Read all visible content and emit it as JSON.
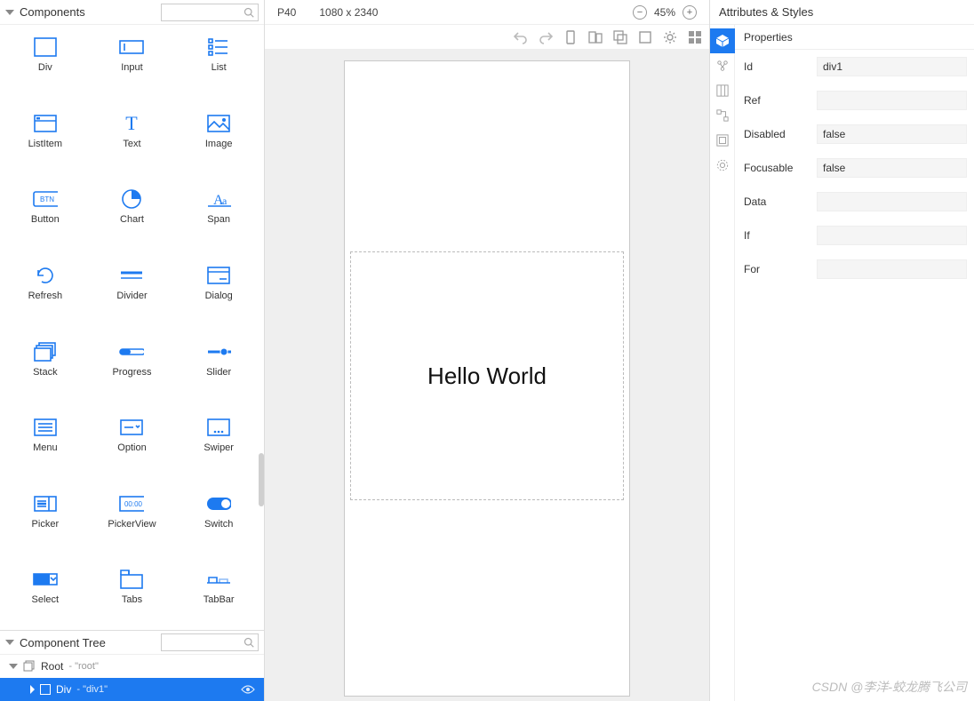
{
  "left": {
    "components_title": "Components",
    "items": [
      {
        "label": "Div"
      },
      {
        "label": "Input"
      },
      {
        "label": "List"
      },
      {
        "label": "ListItem"
      },
      {
        "label": "Text"
      },
      {
        "label": "Image"
      },
      {
        "label": "Button"
      },
      {
        "label": "Chart"
      },
      {
        "label": "Span"
      },
      {
        "label": "Refresh"
      },
      {
        "label": "Divider"
      },
      {
        "label": "Dialog"
      },
      {
        "label": "Stack"
      },
      {
        "label": "Progress"
      },
      {
        "label": "Slider"
      },
      {
        "label": "Menu"
      },
      {
        "label": "Option"
      },
      {
        "label": "Swiper"
      },
      {
        "label": "Picker"
      },
      {
        "label": "PickerView"
      },
      {
        "label": "Switch"
      },
      {
        "label": "Select"
      },
      {
        "label": "Tabs"
      },
      {
        "label": "TabBar"
      }
    ],
    "tree_title": "Component Tree",
    "tree": {
      "root_label": "Root",
      "root_hint": "- \"root\"",
      "div_label": "Div",
      "div_hint": "- \"div1\""
    }
  },
  "canvas": {
    "device": "P40",
    "resolution": "1080 x 2340",
    "zoom": "45%",
    "content_text": "Hello World"
  },
  "right": {
    "title": "Attributes & Styles",
    "section": "Properties",
    "props": [
      {
        "label": "Id",
        "value": "div1"
      },
      {
        "label": "Ref",
        "value": ""
      },
      {
        "label": "Disabled",
        "value": "false"
      },
      {
        "label": "Focusable",
        "value": "false"
      },
      {
        "label": "Data",
        "value": ""
      },
      {
        "label": "If",
        "value": ""
      },
      {
        "label": "For",
        "value": ""
      }
    ]
  },
  "watermark": "CSDN @李洋-蛟龙腾飞公司"
}
